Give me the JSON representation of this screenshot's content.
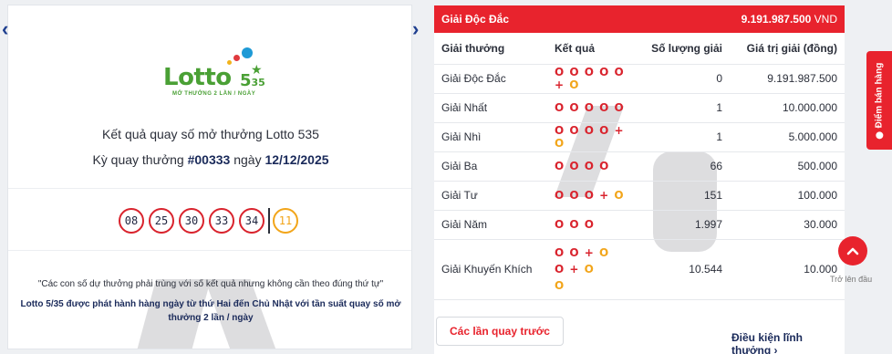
{
  "left": {
    "logo": {
      "word": "Lotto",
      "num": "5",
      "sup": "35",
      "tagline": "MỞ THƯỞNG 2 LẦN / NGÀY"
    },
    "title": "Kết quả quay số mở thưởng Lotto 535",
    "period_prefix": "Kỳ quay thưởng ",
    "period_id": "#00333",
    "period_mid": " ngày ",
    "period_date": "12/12/2025",
    "balls": [
      "08",
      "25",
      "30",
      "33",
      "34"
    ],
    "special_ball": "11",
    "note_1": "\"Các con số dự thưởng phải trùng với số kết quả nhưng không cần theo đúng thứ tự\"",
    "note_2": "Lotto 5/35 được phát hành hàng ngày từ thứ Hai đến Chủ Nhật với tần suất quay số mở thưởng 2 lần / ngày"
  },
  "right": {
    "jackpot_label": "Giải Độc Đắc",
    "jackpot_value": "9.191.987.500",
    "jackpot_unit": " VND",
    "headers": {
      "prize": "Giải thưởng",
      "result": "Kết quả",
      "count": "Số lượng giải",
      "value": "Giá trị giải (đồng)"
    },
    "rows": [
      {
        "name": "Giải Độc Đắc",
        "red": "O O O O O",
        "plus": "+",
        "yellow": "O",
        "count": "0",
        "value": "9.191.987.500"
      },
      {
        "name": "Giải Nhất",
        "red": "O O O O O",
        "plus": "",
        "yellow": "",
        "count": "1",
        "value": "10.000.000"
      },
      {
        "name": "Giải Nhì",
        "red": "O O O O",
        "plus": "+",
        "yellow": "O",
        "count": "1",
        "value": "5.000.000"
      },
      {
        "name": "Giải Ba",
        "red": "O O O O",
        "plus": "",
        "yellow": "",
        "count": "66",
        "value": "500.000"
      },
      {
        "name": "Giải Tư",
        "red": "O O O",
        "plus": "+",
        "yellow": "O",
        "count": "151",
        "value": "100.000"
      },
      {
        "name": "Giải Năm",
        "red": "O O O",
        "plus": "",
        "yellow": "",
        "count": "1.997",
        "value": "30.000"
      }
    ],
    "consolation": {
      "name": "Giải Khuyến Khích",
      "line1_red": "O O",
      "line1_plus": "+",
      "line1_yellow": "O",
      "line2_red": "O",
      "line2_plus": "+",
      "line2_yellow": "O",
      "line3_yellow": "O",
      "count": "10.544",
      "value": "10.000"
    },
    "prev_button": "Các lần quay trước",
    "conditions_link": "Điều kiện lĩnh thưởng ›"
  },
  "floating": {
    "side_tab": "Điểm bán hàng",
    "back_to_top": "Trở lên đầu"
  }
}
